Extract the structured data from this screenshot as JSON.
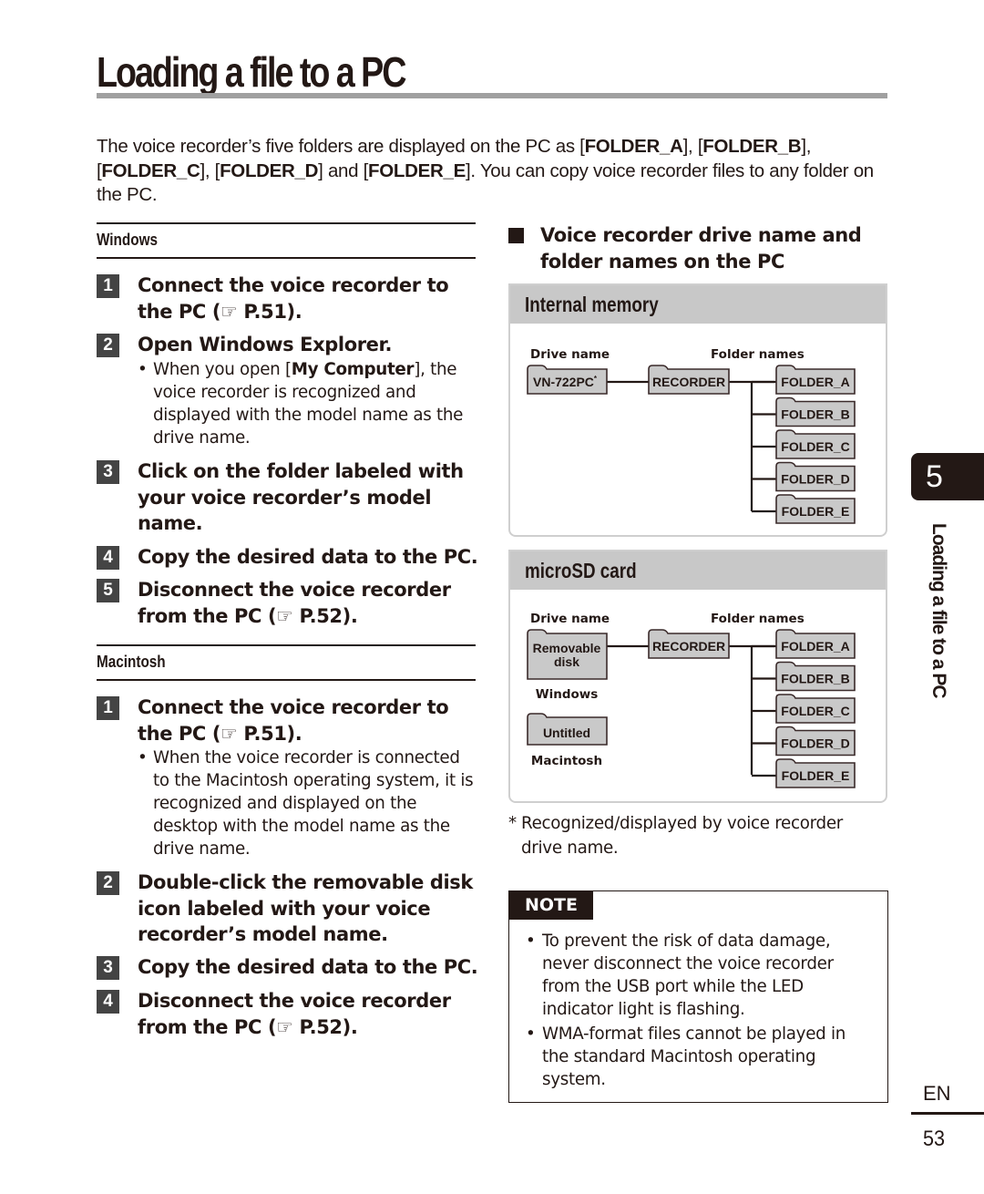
{
  "page": {
    "title": "Loading a file to a PC",
    "intro": {
      "p1": "The voice recorder’s five folders are displayed on the PC as [",
      "f_a": "FOLDER_A",
      "s1": "], [",
      "f_b": "FOLDER_B",
      "s2": "],",
      "s3": "[",
      "f_c": "FOLDER_C",
      "s4": "], [",
      "f_d": "FOLDER_D",
      "s5": "] and [",
      "f_e": "FOLDER_E",
      "s6": "]. You can copy voice recorder files to any folder on the PC."
    }
  },
  "windows": {
    "heading": "Windows",
    "steps": [
      {
        "num": "1",
        "text": "Connect the voice recorder to the PC (☞ P.51)."
      },
      {
        "num": "2",
        "text": "Open Windows Explorer.",
        "bullet_pre": "When you open [",
        "bullet_bold": "My Computer",
        "bullet_post": "], the voice recorder is recognized and displayed with the model name as the drive name."
      },
      {
        "num": "3",
        "text": "Click on the folder labeled with your voice recorder’s model name."
      },
      {
        "num": "4",
        "text": "Copy the desired data to the PC."
      },
      {
        "num": "5",
        "text": "Disconnect the voice recorder from the PC (☞ P.52)."
      }
    ]
  },
  "macintosh": {
    "heading": "Macintosh",
    "steps": [
      {
        "num": "1",
        "text": "Connect the voice recorder to the PC (☞ P.51).",
        "bullet": "When the voice recorder is connected to the Macintosh operating system, it is recognized and displayed on the desktop with the model name as the drive name."
      },
      {
        "num": "2",
        "text": "Double-click the removable disk icon labeled with your voice recorder’s model name."
      },
      {
        "num": "3",
        "text": "Copy the desired data to the PC."
      },
      {
        "num": "4",
        "text": "Disconnect the voice recorder from the PC (☞ P.52)."
      }
    ]
  },
  "drive_section": {
    "heading": "Voice recorder drive name and folder names on the PC",
    "internal": {
      "title": "Internal memory",
      "drive_label": "Drive name",
      "folder_label": "Folder names",
      "drive": "VN-722PC",
      "drive_mark": "*",
      "root": "RECORDER",
      "folders": [
        "FOLDER_A",
        "FOLDER_B",
        "FOLDER_C",
        "FOLDER_D",
        "FOLDER_E"
      ]
    },
    "microsd": {
      "title": "microSD card",
      "drive_label": "Drive name",
      "folder_label": "Folder names",
      "windows_drive_l1": "Removable",
      "windows_drive_l2": "disk",
      "windows_label": "Windows",
      "mac_drive": "Untitled",
      "mac_label": "Macintosh",
      "root": "RECORDER",
      "folders": [
        "FOLDER_A",
        "FOLDER_B",
        "FOLDER_C",
        "FOLDER_D",
        "FOLDER_E"
      ]
    },
    "footnote_star": "*",
    "footnote": "Recognized/displayed by voice recorder drive name."
  },
  "note": {
    "tag": "NOTE",
    "items": [
      "To prevent the risk of data damage, never disconnect the voice recorder from the USB port while the LED indicator light is flashing.",
      "WMA-format files cannot be played in the standard Macintosh operating system."
    ]
  },
  "side": {
    "chapter": "5",
    "title": "Loading a file to a PC",
    "lang": "EN",
    "page_number": "53"
  }
}
